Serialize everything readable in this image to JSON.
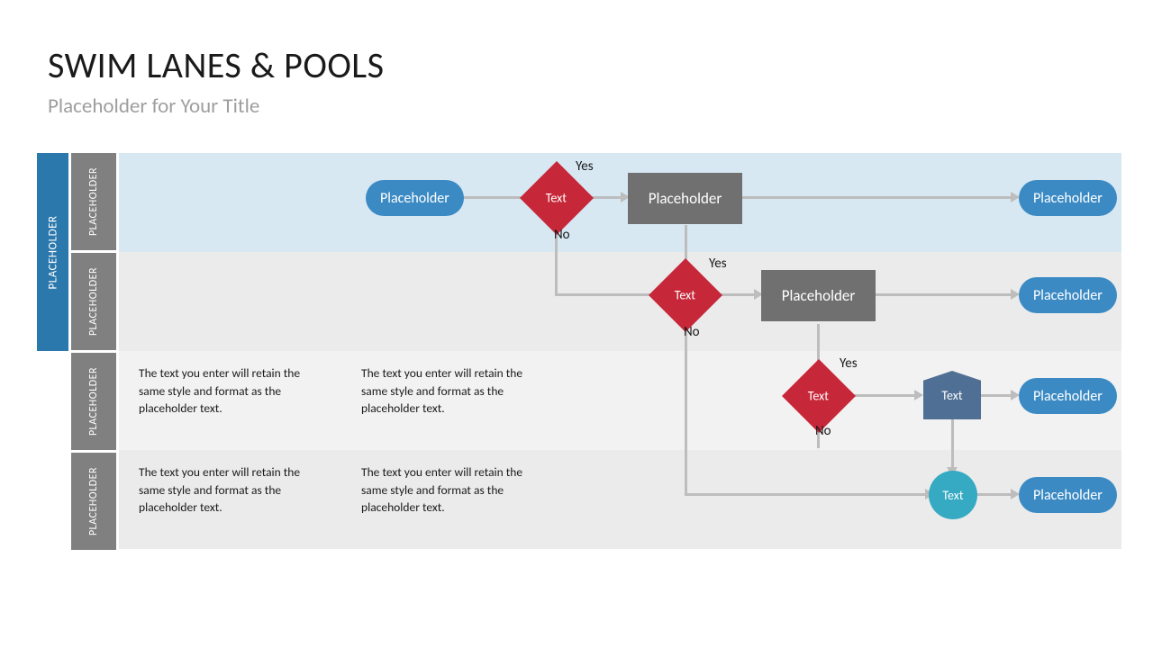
{
  "title": "SWIM LANES & POOLS",
  "subtitle": "Placeholder for Your Title",
  "pool_header": "PLACEHOLDER",
  "lanes": [
    "PLACEHOLDER",
    "PLACEHOLDER",
    "PLACEHOLDER",
    "PLACEHOLDER"
  ],
  "nodes": {
    "start": "Placeholder",
    "d1": "Text",
    "d2": "Text",
    "d3": "Text",
    "r1": "Placeholder",
    "r2": "Placeholder",
    "pent": "Text",
    "circ": "Text",
    "end1": "Placeholder",
    "end2": "Placeholder",
    "end3": "Placeholder",
    "end4": "Placeholder"
  },
  "labels": {
    "yes": "Yes",
    "no": "No"
  },
  "para": "The text you enter will retain the same style and format as the placeholder text.",
  "colors": {
    "accent": "#3b8ac4",
    "pool": "#2b78ad",
    "lane_hdr": "#808080",
    "decision": "#c62839",
    "process": "#707070",
    "pent": "#4f6f94",
    "circle": "#35aac2",
    "connector": "#bdbdbd",
    "lane1": "#d7e8f3",
    "lane_alt": "#ebebeb",
    "lane_alt2": "#f2f2f2"
  }
}
